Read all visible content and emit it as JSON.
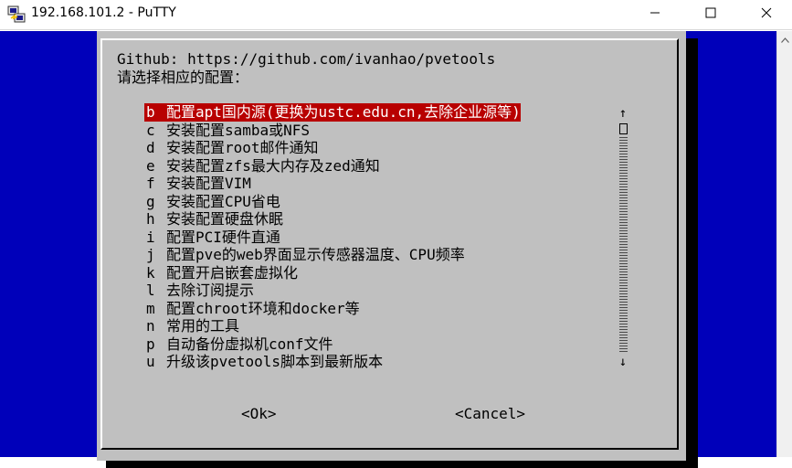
{
  "window": {
    "title": "192.168.101.2 - PuTTY"
  },
  "dialog": {
    "github_line": "Github: https://github.com/ivanhao/pvetools",
    "prompt": "请选择相应的配置：",
    "items": [
      {
        "key": "b",
        "label": "配置apt国内源(更换为ustc.edu.cn,去除企业源等)",
        "selected": true
      },
      {
        "key": "c",
        "label": "安装配置samba或NFS",
        "selected": false
      },
      {
        "key": "d",
        "label": "安装配置root邮件通知",
        "selected": false
      },
      {
        "key": "e",
        "label": "安装配置zfs最大内存及zed通知",
        "selected": false
      },
      {
        "key": "f",
        "label": "安装配置VIM",
        "selected": false
      },
      {
        "key": "g",
        "label": "安装配置CPU省电",
        "selected": false
      },
      {
        "key": "h",
        "label": "安装配置硬盘休眠",
        "selected": false
      },
      {
        "key": "i",
        "label": "配置PCI硬件直通",
        "selected": false
      },
      {
        "key": "j",
        "label": "配置pve的web界面显示传感器温度、CPU频率",
        "selected": false
      },
      {
        "key": "k",
        "label": "配置开启嵌套虚拟化",
        "selected": false
      },
      {
        "key": "l",
        "label": "去除订阅提示",
        "selected": false
      },
      {
        "key": "m",
        "label": "配置chroot环境和docker等",
        "selected": false
      },
      {
        "key": "n",
        "label": "常用的工具",
        "selected": false
      },
      {
        "key": "p",
        "label": "自动备份虚拟机conf文件",
        "selected": false
      },
      {
        "key": "u",
        "label": "升级该pvetools脚本到最新版本",
        "selected": false
      }
    ],
    "ok_label": "<Ok>",
    "cancel_label": "<Cancel>",
    "scroll_up_glyph": "↑",
    "scroll_down_glyph": "↓"
  },
  "colors": {
    "terminal_bg": "#0000ba",
    "dialog_bg": "#c0c0c0",
    "selection_bg": "#b80000"
  },
  "icons": {
    "app": "putty-icon",
    "minimize": "minimize-icon",
    "maximize": "maximize-icon",
    "close": "close-icon"
  }
}
